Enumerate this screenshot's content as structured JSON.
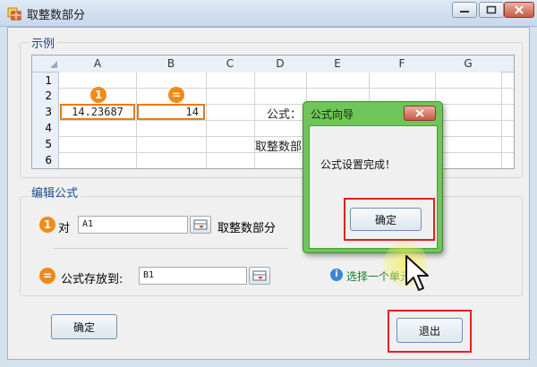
{
  "window": {
    "title": "取整数部分",
    "icon": "spreadsheet-app-icon"
  },
  "example": {
    "group_title": "示例",
    "columns": [
      "A",
      "B",
      "C",
      "D",
      "E",
      "F",
      "G"
    ],
    "rows": [
      "1",
      "2",
      "3",
      "4",
      "5",
      "6"
    ],
    "badge1": "1",
    "badge_eq": "=",
    "a3_value": "14.23687",
    "b3_value": "14",
    "formula_label": "公式：",
    "formula_desc": "取整数部"
  },
  "edit": {
    "group_title": "编辑公式",
    "row1_badge": "1",
    "row1_label": "对",
    "row1_value": "A1",
    "row1_suffix": "取整数部分",
    "row2_badge": "=",
    "row2_label": "公式存放到:",
    "row2_value": "B1",
    "hint_icon": "i",
    "hint_text": "选择一个单元"
  },
  "buttons": {
    "ok": "确定",
    "exit": "退出"
  },
  "dialog": {
    "title": "公式向导",
    "message": "公式设置完成！",
    "ok": "确定"
  },
  "colors": {
    "badge": "#f08a18",
    "highlight": "#e02020",
    "dialog_frame": "#6fc45a"
  }
}
